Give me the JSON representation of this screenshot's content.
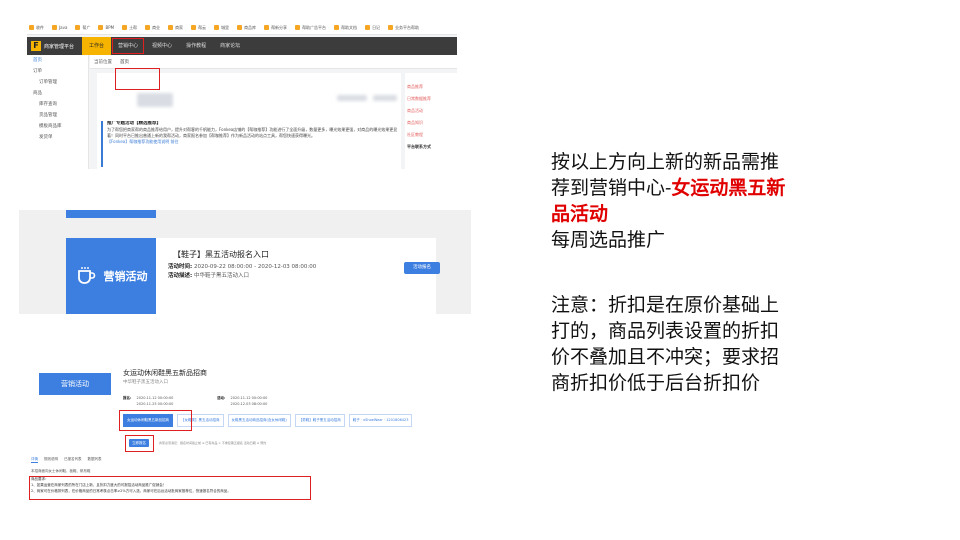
{
  "screenshot1": {
    "bookmarks": [
      "收件",
      "Java",
      "帮广",
      "BPM",
      "土帮",
      "商业",
      "商家",
      "帮云",
      "城里",
      "商品库",
      "帮新分享",
      "帮助广告平台",
      "帮助文档",
      "日记",
      "业务平台帮助"
    ],
    "app_name": "商家管理平台",
    "nav_tabs": [
      "工作台",
      "营销中心",
      "视频中心",
      "操作教程",
      "商家论坛"
    ],
    "sidebar_items": [
      "首页",
      "订单",
      "订单管理",
      "商品",
      "库存查询",
      "货品管理",
      "模板商品库",
      "发货单"
    ],
    "breadcrumb": [
      "当前位置",
      "首页"
    ],
    "notice": {
      "title": "推广专题活动【精选推荐】",
      "body": "为了帮您把商家帮的商品推荐给用户，提升对帮客的千帆能力，Fonkea店铺的【帮咖推荐】功能进行了全面升级，数量更多，曝光效果更强，对商品的曝光效果更显著！同时平台已推出普通上新的我帮活动，商家报名参加【帮咖推荐】作为新品活动的站点工具，帮您快速获得曝光。",
      "link": "【Fonkea】帮咖推荐功能使用说明 前往"
    },
    "right_links": [
      "商品推荐",
      "日常数据推荐",
      "商品活动",
      "商品知识",
      "社区教程",
      "帮助说明"
    ],
    "right_heading": "平台联系方式"
  },
  "screenshot2": {
    "card_label": "营销活动",
    "title": "【鞋子】黑五活动报名入口",
    "time_label": "活动时间:",
    "time_value": "2020-09-22 08:00:00 - 2020-12-03 08:00:00",
    "desc_label": "活动描述:",
    "desc_value": "中华鞋子黑五活动入口",
    "button": "活动报名"
  },
  "screenshot3": {
    "card_label": "营销活动",
    "title": "女运动休闲鞋黑五新品招商",
    "subtitle": "中华鞋子黑五活动入口",
    "meta_left_label": "报名:",
    "meta_left_values": [
      "2020.11.12 00:00:00",
      "2020.11.25 00:00:00"
    ],
    "meta_right_label": "活动:",
    "meta_right_values": [
      "2020.11.12 00:00:00",
      "2020.12.03 08:00:00"
    ],
    "links": [
      "女运动休闲鞋黑五新品招商",
      "【女鞋类】黑五活动招商",
      "女鞋黑五活动商品招商(含女休闲鞋)",
      "【男鞋】鞋子黑五活动招商",
      "鞋子 · xShoeWear · 1201806423"
    ],
    "button": "立即报名",
    "button_note": "商家必须满足：报名时间截止前 ≥ 已有商品 × 不重复黑五报名 活动日期 ≥ 预约",
    "tabs": [
      "详情",
      "规则说明",
      "已报名列表",
      "数据列表"
    ],
    "scope": "本招商面向女士休闲鞋、板鞋、帆布鞋",
    "requirements": [
      "商品要求：",
      "1、如果运营在商家列表的所在门店上新，且折扣力度大的可报招活动商品推广促销会！",
      "2、商家可在价格排列表，在价格商品的日常考核点击率≥2%方可入选，商家可在后台活动批商家推荐位，快速报名符合的商品。"
    ]
  },
  "right_text": {
    "line1": "按以上方向上新的新品需推",
    "line2_plain": "荐到营销中心-",
    "line2_red": "女运动黑五新",
    "line3_red": "品活动",
    "line4": "每周选品推广",
    "note": [
      "注意：折扣是在原价基础上",
      "打的，商品列表设置的折扣",
      "价不叠加且不冲突；要求招",
      "商折扣价低于后台折扣价"
    ],
    "accent_color": "#e00000"
  }
}
